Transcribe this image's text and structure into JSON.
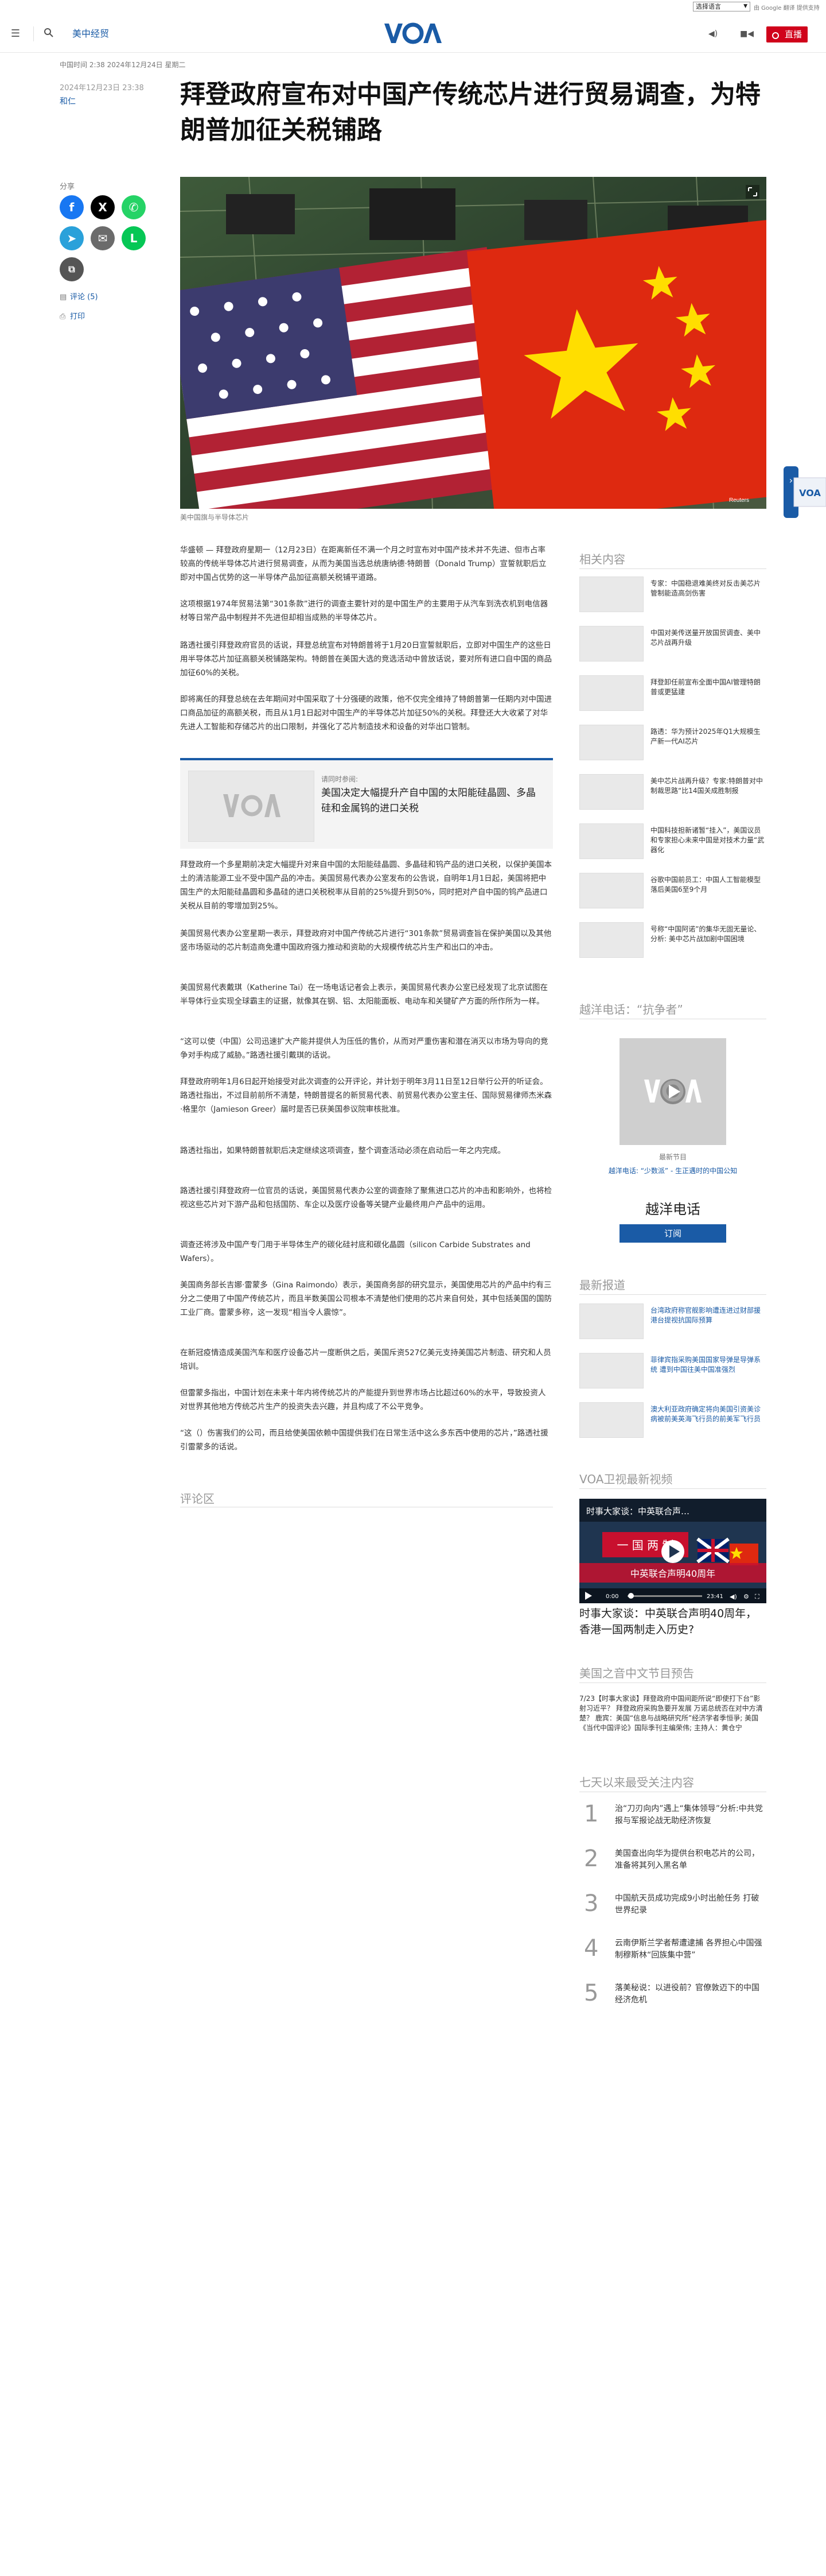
{
  "translate": {
    "select_label": "选择语言",
    "powered": "由 Google 翻译 提供支持"
  },
  "header": {
    "section": "美中经贸",
    "logo_text": "VOA",
    "live_label": "直播",
    "icons": [
      "menu-icon",
      "search-icon",
      "audio-icon",
      "video-icon"
    ]
  },
  "article": {
    "meta": "中国时间 2:38 2024年12月24日 星期二",
    "date": "2024年12月23日 23:38",
    "author": "和仁",
    "title": "拜登政府宣布对中国产传统芯片进行贸易调查，为特朗普加征关税铺路",
    "image_caption": "美中国旗与半导体芯片",
    "image_credit": "Reuters",
    "share_label": "分享",
    "comments_link": "评论 (5)",
    "print_link": "打印",
    "paragraphs": [
      "华盛顿 — 拜登政府星期一（12月23日）在距离新任不满一个月之时宣布对中国产技术并不先进、但市占率较高的传统半导体芯片进行贸易调查，从而为美国当选总统唐纳德·特朗普（Donald Trump）宣誓就职后立即对中国占优势的这一半导体产品加征高额关税铺平道路。",
      "这项根据1974年贸易法第“301条款”进行的调查主要针对的是中国生产的主要用于从汽车到洗衣机到电信器材等日常产品中制程并不先进但却相当成熟的半导体芯片。",
      "路透社援引拜登政府官员的话说，拜登总统宣布对特朗普将于1月20日宣誓就职后，立即对中国生产的这些日用半导体芯片加征高额关税铺路架构。特朗普在美国大选的竞选活动中曾放话说，要对所有进口自中国的商品加征60%的关税。",
      "即将离任的拜登总统在去年期间对中国采取了十分强硬的政策，他不仅完全维持了特朗普第一任期内对中国进口商品加征的高额关税，而且从1月1日起对中国生产的半导体芯片加征50%的关税。拜登还大大收紧了对华先进人工智能和存储芯片的出口限制，并强化了芯片制造技术和设备的对华出口管制。",
      "拜登政府一个多星期前决定大幅提升对来自中国的太阳能硅晶圆、多晶硅和钨产品的进口关税，以保护美国本土的清洁能源工业不受中国产品的冲击。美国贸易代表办公室发布的公告说，自明年1月1日起，美国将把中国生产的太阳能硅晶圆和多晶硅的进口关税税率从目前的25%提升到50%，同时把对产自中国的钨产品进口关税从目前的零增加到25%。",
      "美国贸易代表办公室星期一表示，拜登政府对中国产传统芯片进行“301条款”贸易调查旨在保护美国以及其他竖市场驱动的芯片制造商免遭中国政府强力推动和资助的大规模传统芯片生产和出口的冲击。",
      "美国贸易代表戴琪（Katherine Tai）在一场电话记者会上表示，美国贸易代表办公室已经发现了北京试图在半导体行业实现全球霸主的证据，就像其在钢、铝、太阳能面板、电动车和关键矿产方面的所作所为一样。",
      "“这可以使（中国）公司迅速扩大产能并提供人为压低的售价，从而对严重伤害和潜在消灭以市场为导向的竞争对手构成了威胁。”路透社援引戴琪的话说。",
      "拜登政府明年1月6日起开始接受对此次调查的公开评论，并计划于明年3月11日至12日举行公开的听证会。路透社指出，不过目前前所不清楚，特朗普提名的新贸易代表、前贸易代表办公室主任、国际贸易律师杰米森·格里尔（Jamieson Greer）届时是否已获美国参议院审核批准。",
      "路透社指出，如果特朗普就职后决定继续这项调查，整个调查活动必须在启动后一年之内完成。",
      "路透社援引拜登政府一位官员的话说，美国贸易代表办公室的调查除了聚焦进口芯片的冲击和影响外，也将检视这些芯片对下游产品和包括国防、车企以及医疗设备等关键产业最终用户产品中的运用。",
      "调查还将涉及中国产专门用于半导体生产的碳化硅衬底和碳化晶圆（silicon Carbide Substrates and Wafers）。",
      "美国商务部长吉娜·雷蒙多（Gina Raimondo）表示，美国商务部的研究显示，美国使用芯片的产品中约有三分之二使用了中国产传统芯片，而且半数美国公司根本不清楚他们使用的芯片来自何处，其中包括美国的国防工业厂商。雷蒙多称，这一发现“相当令人震惊”。",
      "在新冠疫情造成美国汽车和医疗设备芯片一度断供之后，美国斥资527亿美元支持美国芯片制造、研究和人员培训。",
      "但雷蒙多指出，中国计划在未来十年内将传统芯片的产能提升到世界市场占比超过60%的水平，导致投资人对世界其他地方传统芯片生产的投资失去兴趣，并且构成了不公平竞争。",
      "“这（）伤害我们的公司，而且给使美国依赖中国提供我们在日常生活中这么多东西中使用的芯片，”路透社援引雷蒙多的话说。"
    ],
    "related_inline": {
      "kicker": "请同时参阅:",
      "title": "美国决定大幅提升产自中国的太阳能硅晶圆、多晶硅和金属钨的进口关税"
    },
    "comments_heading": "评论区"
  },
  "rail": {
    "related_heading": "相关内容",
    "related": [
      "专家：中国稳退难美终对反击美芯片管制能造高剑伤害",
      "中国对美传送量开放国贸调查、美中芯片战再升级",
      "拜登卸任前宣布全面中国AI管理特朗普或更猛建",
      "路透：华为预计2025年Q1大规模生产新一代AI芯片",
      "美中芯片战再升级？专家:特朗普对中制裁思路“比14国关成胜制报",
      "中国科技担新诸暂“挂入”，美国议员和专家担心未来中国是对技术力量“武器化",
      "谷歌中国前员工：中国人工智能模型落后美国6至9个月",
      "号称“中国阿诺”的集华无固无量论、分析: 美中芯片战加剧中国困境"
    ],
    "podcast_heading": "越洋电话：“抗争者”",
    "podcast_kicker": "最新节目",
    "podcast_link": "越洋电话: “少数派” - 生正遇时的中国公知",
    "podcast_name": "越洋电话",
    "podcast_subscribe": "订阅",
    "latest_heading": "最新报道",
    "latest": [
      "台湾政府称官舰影响遭连进过财部援港台提视抗国际预算",
      "菲律宾指采购美国国家导弹是导弹系统 遭到中国往美中国准强烈",
      "澳大利亚政府确定将向美国引资美诊病被前美英海飞行员的前美军飞行员"
    ],
    "video_heading": "VOA卫视最新视频",
    "video_overlay": "时事大家谈：中英联合声…",
    "video_banner": "中英联合声明40周年",
    "video_time": "0:00",
    "video_duration": "23:41",
    "video_title": "时事大家谈：中英联合声明40周年，香港一国两制走入历史?",
    "schedule_heading": "美国之音中文节目预告",
    "schedule_text": "7/23【时事大家谈】拜登政府中国间距所说“即使打下台”影射习近平？ 拜登政府采购急要开发展 万诺总统否在对中方清楚？ 鹿宾：美国“信息与战略研究所”经济学者季恒爭; 美国《当代中国评论》国际季刊主编荣伟; 主持人：黄仓宁",
    "popular_heading": "七天以来最受关注内容",
    "popular": [
      "治“刀刃向内”遇上“集体领导”分析:中共党报与军报论战无助经济恢复",
      "美国查出向华为提供台积电芯片的公司，准备将其列入黑名单",
      "中国航天员成功完成9小时出舱任务 打破世界纪录",
      "云南伊斯兰学者帮遭逮捕 各界担心中国强制穆斯林“回族集中营”",
      "落美秘说：以进役前？官僚敦迈下的中国经济危机"
    ]
  }
}
